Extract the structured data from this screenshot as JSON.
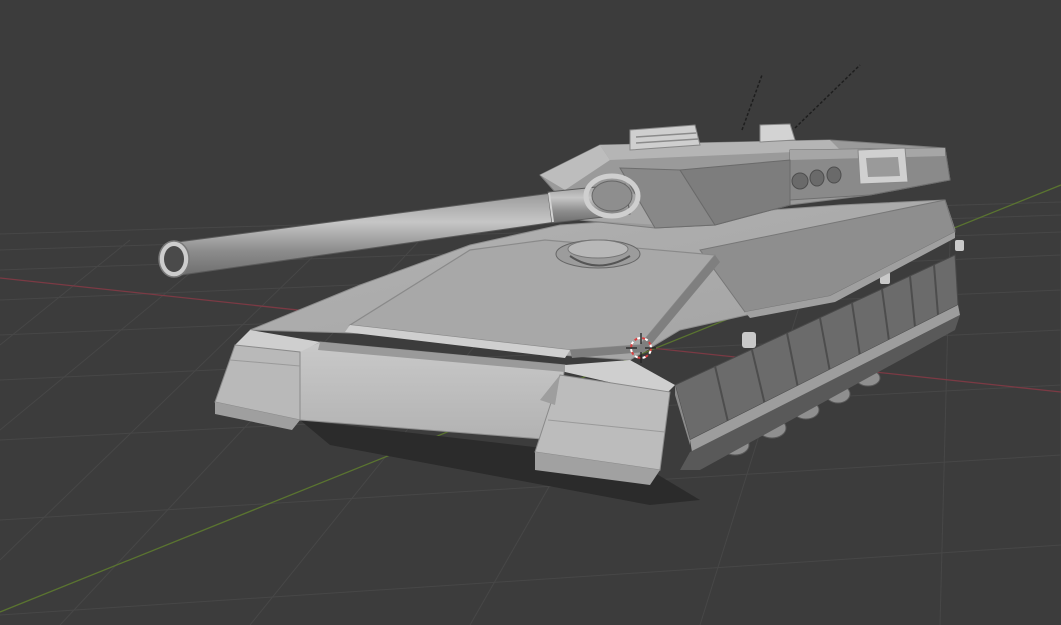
{
  "viewport": {
    "background_color": "#3c3c3c",
    "grid_color": "#4a4a4a",
    "x_axis_color": "#8a3a44",
    "y_axis_color": "#5d7a2c"
  },
  "scene": {
    "object": "tank-model",
    "shading": "solid-gray",
    "model_color": "#b8b8b8",
    "cursor_icon": "3d-cursor-icon"
  }
}
